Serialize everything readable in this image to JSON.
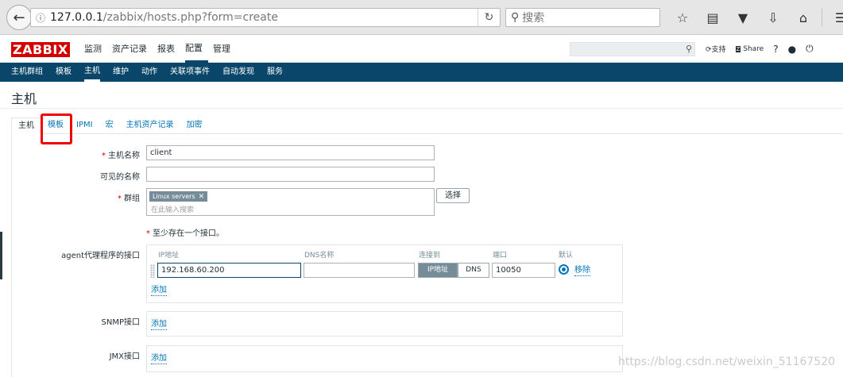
{
  "browser": {
    "url_host": "127.0.0.1",
    "url_path": "/zabbix/hosts.php?form=create",
    "search_placeholder": "搜索"
  },
  "header": {
    "logo": "ZABBIX",
    "menu": [
      "监测",
      "资产记录",
      "报表",
      "配置",
      "管理"
    ],
    "active_menu": "配置",
    "support": "支持",
    "share": "Share",
    "help": "?"
  },
  "subnav": {
    "items": [
      "主机群组",
      "模板",
      "主机",
      "维护",
      "动作",
      "关联项事件",
      "自动发现",
      "服务"
    ],
    "active": "主机"
  },
  "page": {
    "title": "主机"
  },
  "tabs": [
    "主机",
    "模板",
    "IPMI",
    "宏",
    "主机资产记录",
    "加密"
  ],
  "form": {
    "host_name_label": "主机名称",
    "host_name_value": "client",
    "visible_name_label": "可见的名称",
    "visible_name_value": "",
    "groups_label": "群组",
    "group_chip": "Linux servers",
    "groups_placeholder": "在此输入搜索",
    "select_button": "选择",
    "interface_note": "至少存在一个接口。",
    "agent_label": "agent代理程序的接口",
    "cols": {
      "ip": "IP地址",
      "dns": "DNS名称",
      "connect": "连接到",
      "port": "端口",
      "default": "默认"
    },
    "ip_value": "192.168.60.200",
    "dns_value": "",
    "connect_ip": "IP地址",
    "connect_dns": "DNS",
    "port_value": "10050",
    "remove_link": "移除",
    "add_link": "添加",
    "snmp_label": "SNMP接口",
    "jmx_label": "JMX接口"
  },
  "watermark": "https://blog.csdn.net/weixin_51167520"
}
